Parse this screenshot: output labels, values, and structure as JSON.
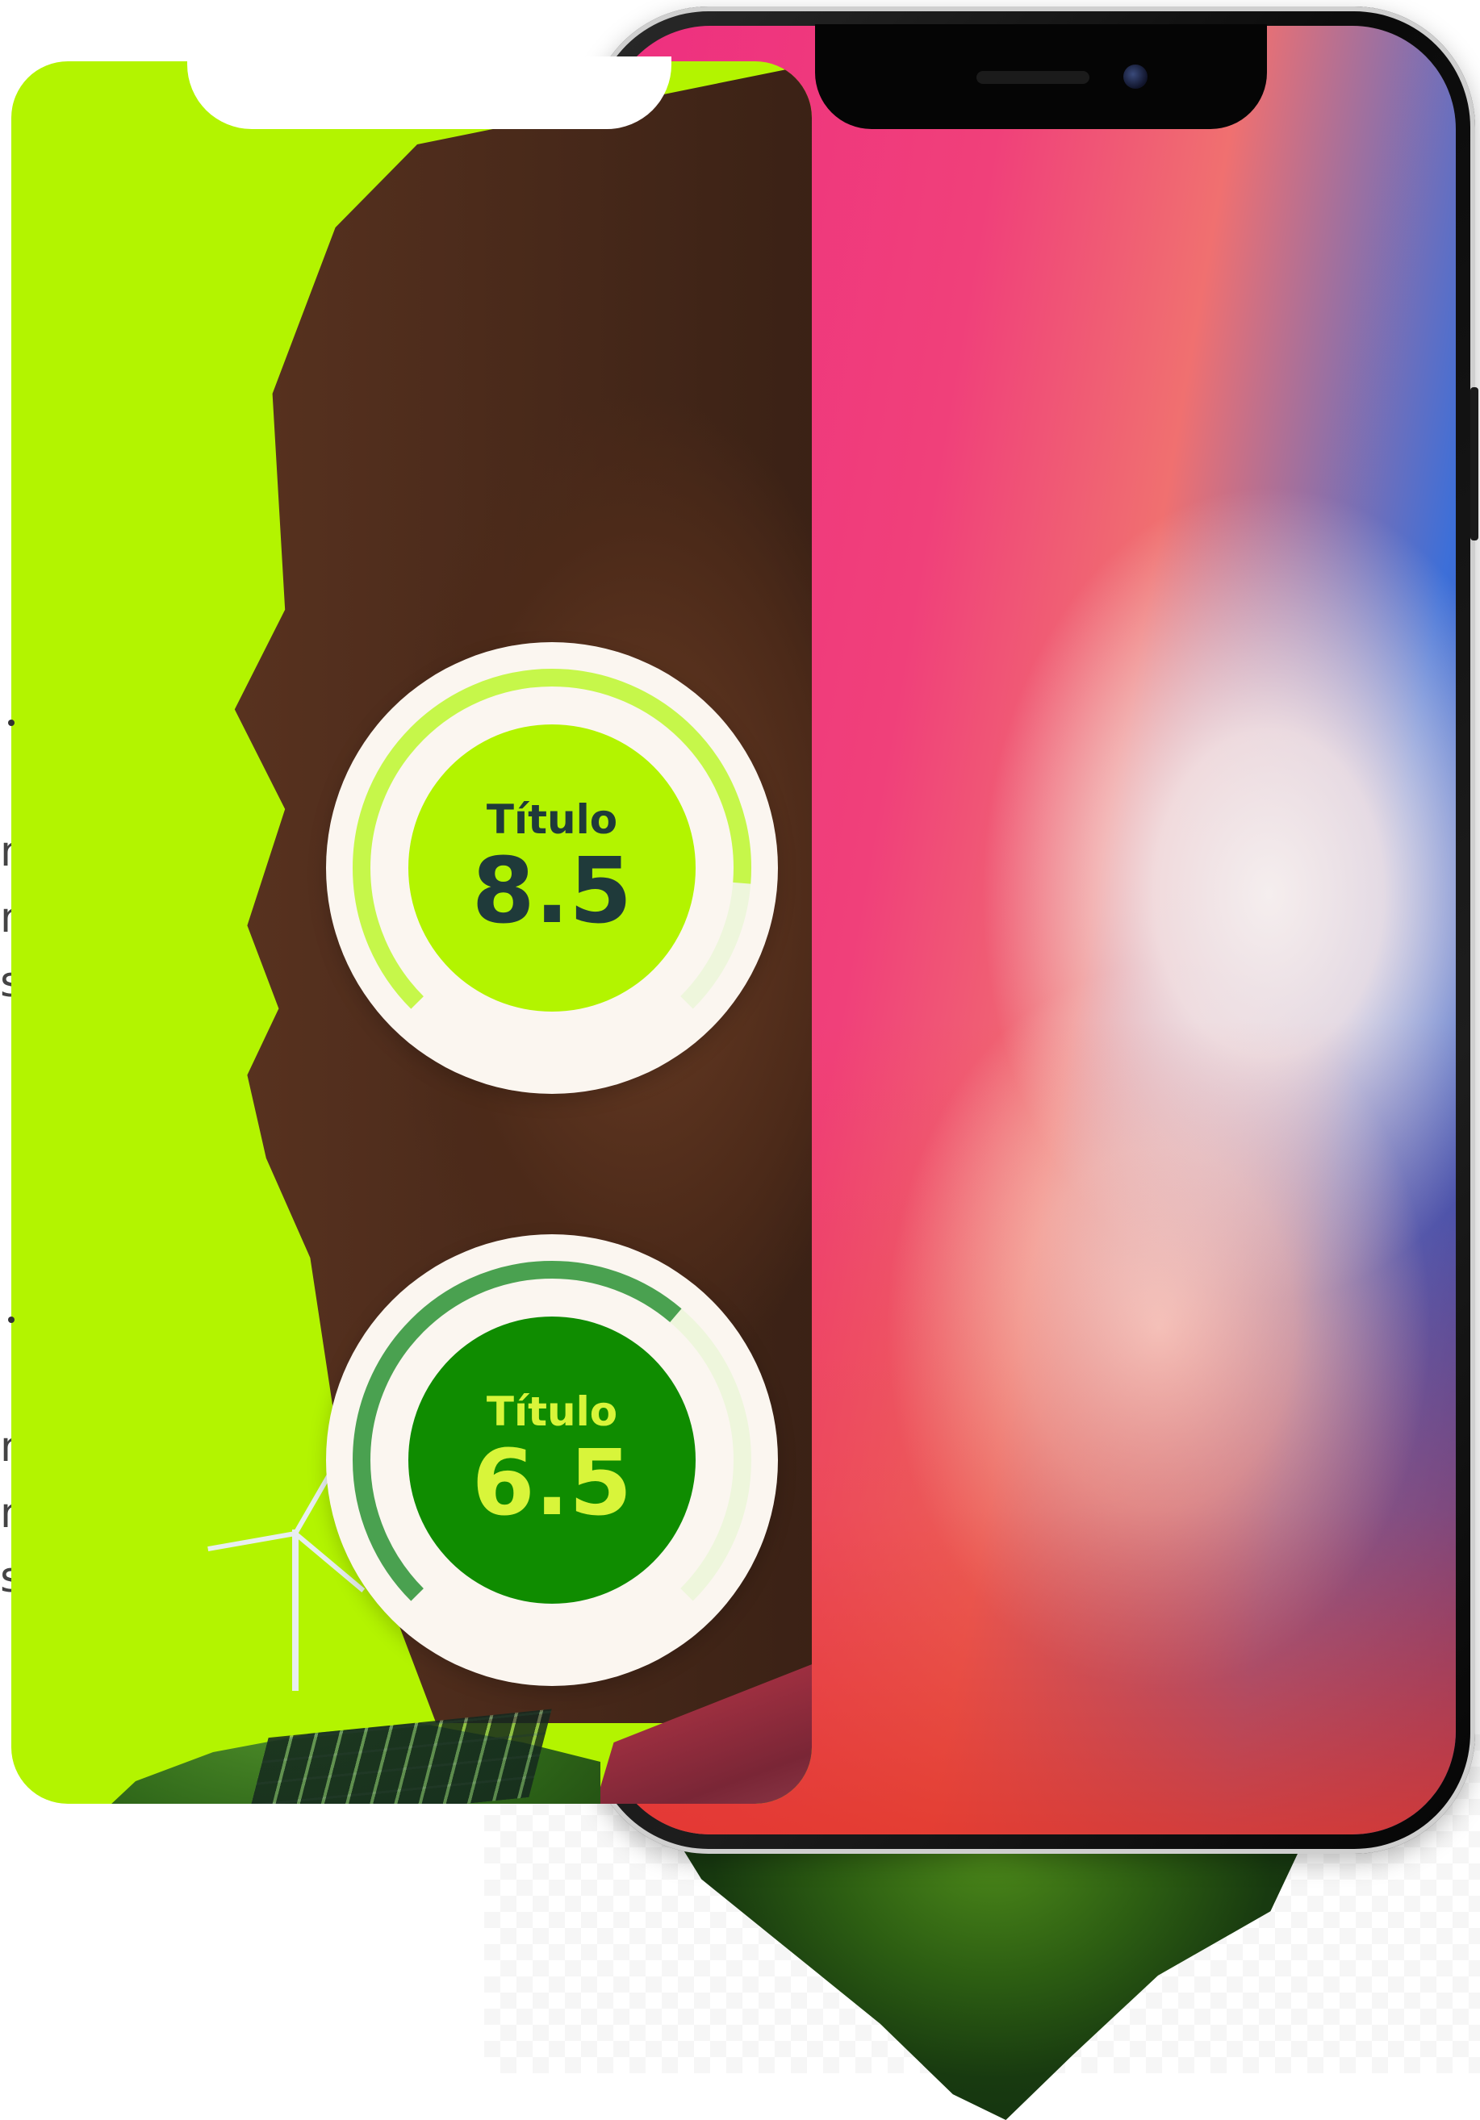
{
  "gauges": [
    {
      "title": "Título",
      "value": "8.5",
      "score": 8.5,
      "max": 10
    },
    {
      "title": "Título",
      "value": "6.5",
      "score": 6.5,
      "max": 10
    }
  ],
  "edge_fragments": [
    "n",
    "n",
    "s",
    "n",
    "n",
    "s"
  ],
  "colors": {
    "card_green": "#b3f400",
    "gauge_one_inner": "#b3f400",
    "gauge_one_arc": "#c6f74a",
    "gauge_two_inner": "#0f8c00",
    "gauge_two_arc": "#4aa150",
    "gauge_two_text": "#d8f53a",
    "gauge_face": "#fbf6f0",
    "text_dark": "#1f3a3a"
  },
  "icons": [
    "front-camera-icon",
    "earpiece-speaker-icon",
    "wind-turbine-icon",
    "solar-panel-icon"
  ]
}
